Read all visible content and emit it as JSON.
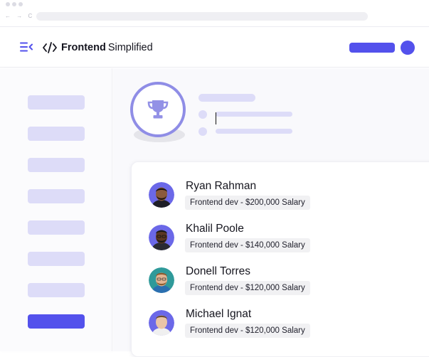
{
  "browser": {
    "nav_icons": "← → C"
  },
  "header": {
    "brand_name": "Frontend",
    "brand_sub": "Simplified",
    "accent_color": "#5351ec"
  },
  "sidebar": {
    "items": [
      {
        "state": "placeholder"
      },
      {
        "state": "placeholder"
      },
      {
        "state": "placeholder"
      },
      {
        "state": "placeholder"
      },
      {
        "state": "placeholder"
      },
      {
        "state": "placeholder"
      },
      {
        "state": "placeholder"
      },
      {
        "state": "active"
      }
    ]
  },
  "hero": {
    "icon": "trophy-icon"
  },
  "leaderboard": {
    "people": [
      {
        "name": "Ryan Rahman",
        "role": "Frontend dev - $200,000 Salary",
        "avatar_bg": "#6b68e8",
        "skin": "#8a5a3c",
        "hair": "#1c140f"
      },
      {
        "name": "Khalil Poole",
        "role": "Frontend dev - $140,000 Salary",
        "avatar_bg": "#6b68e8",
        "skin": "#5a3722",
        "hair": "#181818"
      },
      {
        "name": "Donell Torres",
        "role": "Frontend dev - $120,000 Salary",
        "avatar_bg": "#2f9a9a",
        "skin": "#e2b491",
        "hair": "#8a5b2f"
      },
      {
        "name": "Michael Ignat",
        "role": "Frontend dev - $120,000 Salary",
        "avatar_bg": "#6b68e8",
        "skin": "#e9c4a7",
        "hair": "#6b4d33"
      }
    ]
  }
}
